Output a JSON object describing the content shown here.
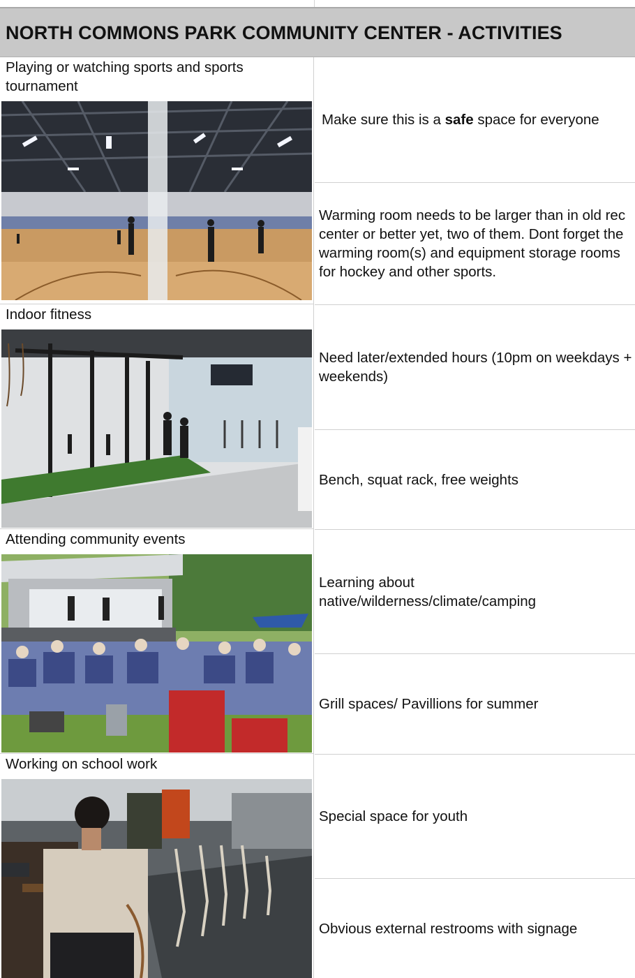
{
  "title": "NORTH COMMONS PARK COMMUNITY CENTER - ACTIVITIES",
  "activities": [
    {
      "label": "Playing or watching sports and sports tournament",
      "photo_icon": "gym-court-photo"
    },
    {
      "label": "Indoor fitness",
      "photo_icon": "fitness-gym-photo"
    },
    {
      "label": "Attending community events",
      "photo_icon": "outdoor-concert-photo"
    },
    {
      "label": "Working on school work",
      "photo_icon": "study-hall-photo"
    }
  ],
  "comments": [
    {
      "pre": "Make sure this is a ",
      "bold": "safe",
      "post": " space for everyone"
    },
    {
      "text": "Warming room needs to be larger than in old rec center or better yet, two of them. Dont forget the warming room(s) and equipment storage rooms for hockey and other sports."
    },
    {
      "text": "Need later/extended hours (10pm on weekdays + weekends)"
    },
    {
      "text": "Bench, squat rack, free weights"
    },
    {
      "text": "Learning about native/wilderness/climate/camping"
    },
    {
      "text": "Grill spaces/ Pavillions for summer"
    },
    {
      "text": "Special space for youth"
    },
    {
      "text": "Obvious external restrooms with signage"
    }
  ],
  "colors": {
    "header_bg": "#c8c8c8",
    "grid": "#d0d0d0"
  }
}
